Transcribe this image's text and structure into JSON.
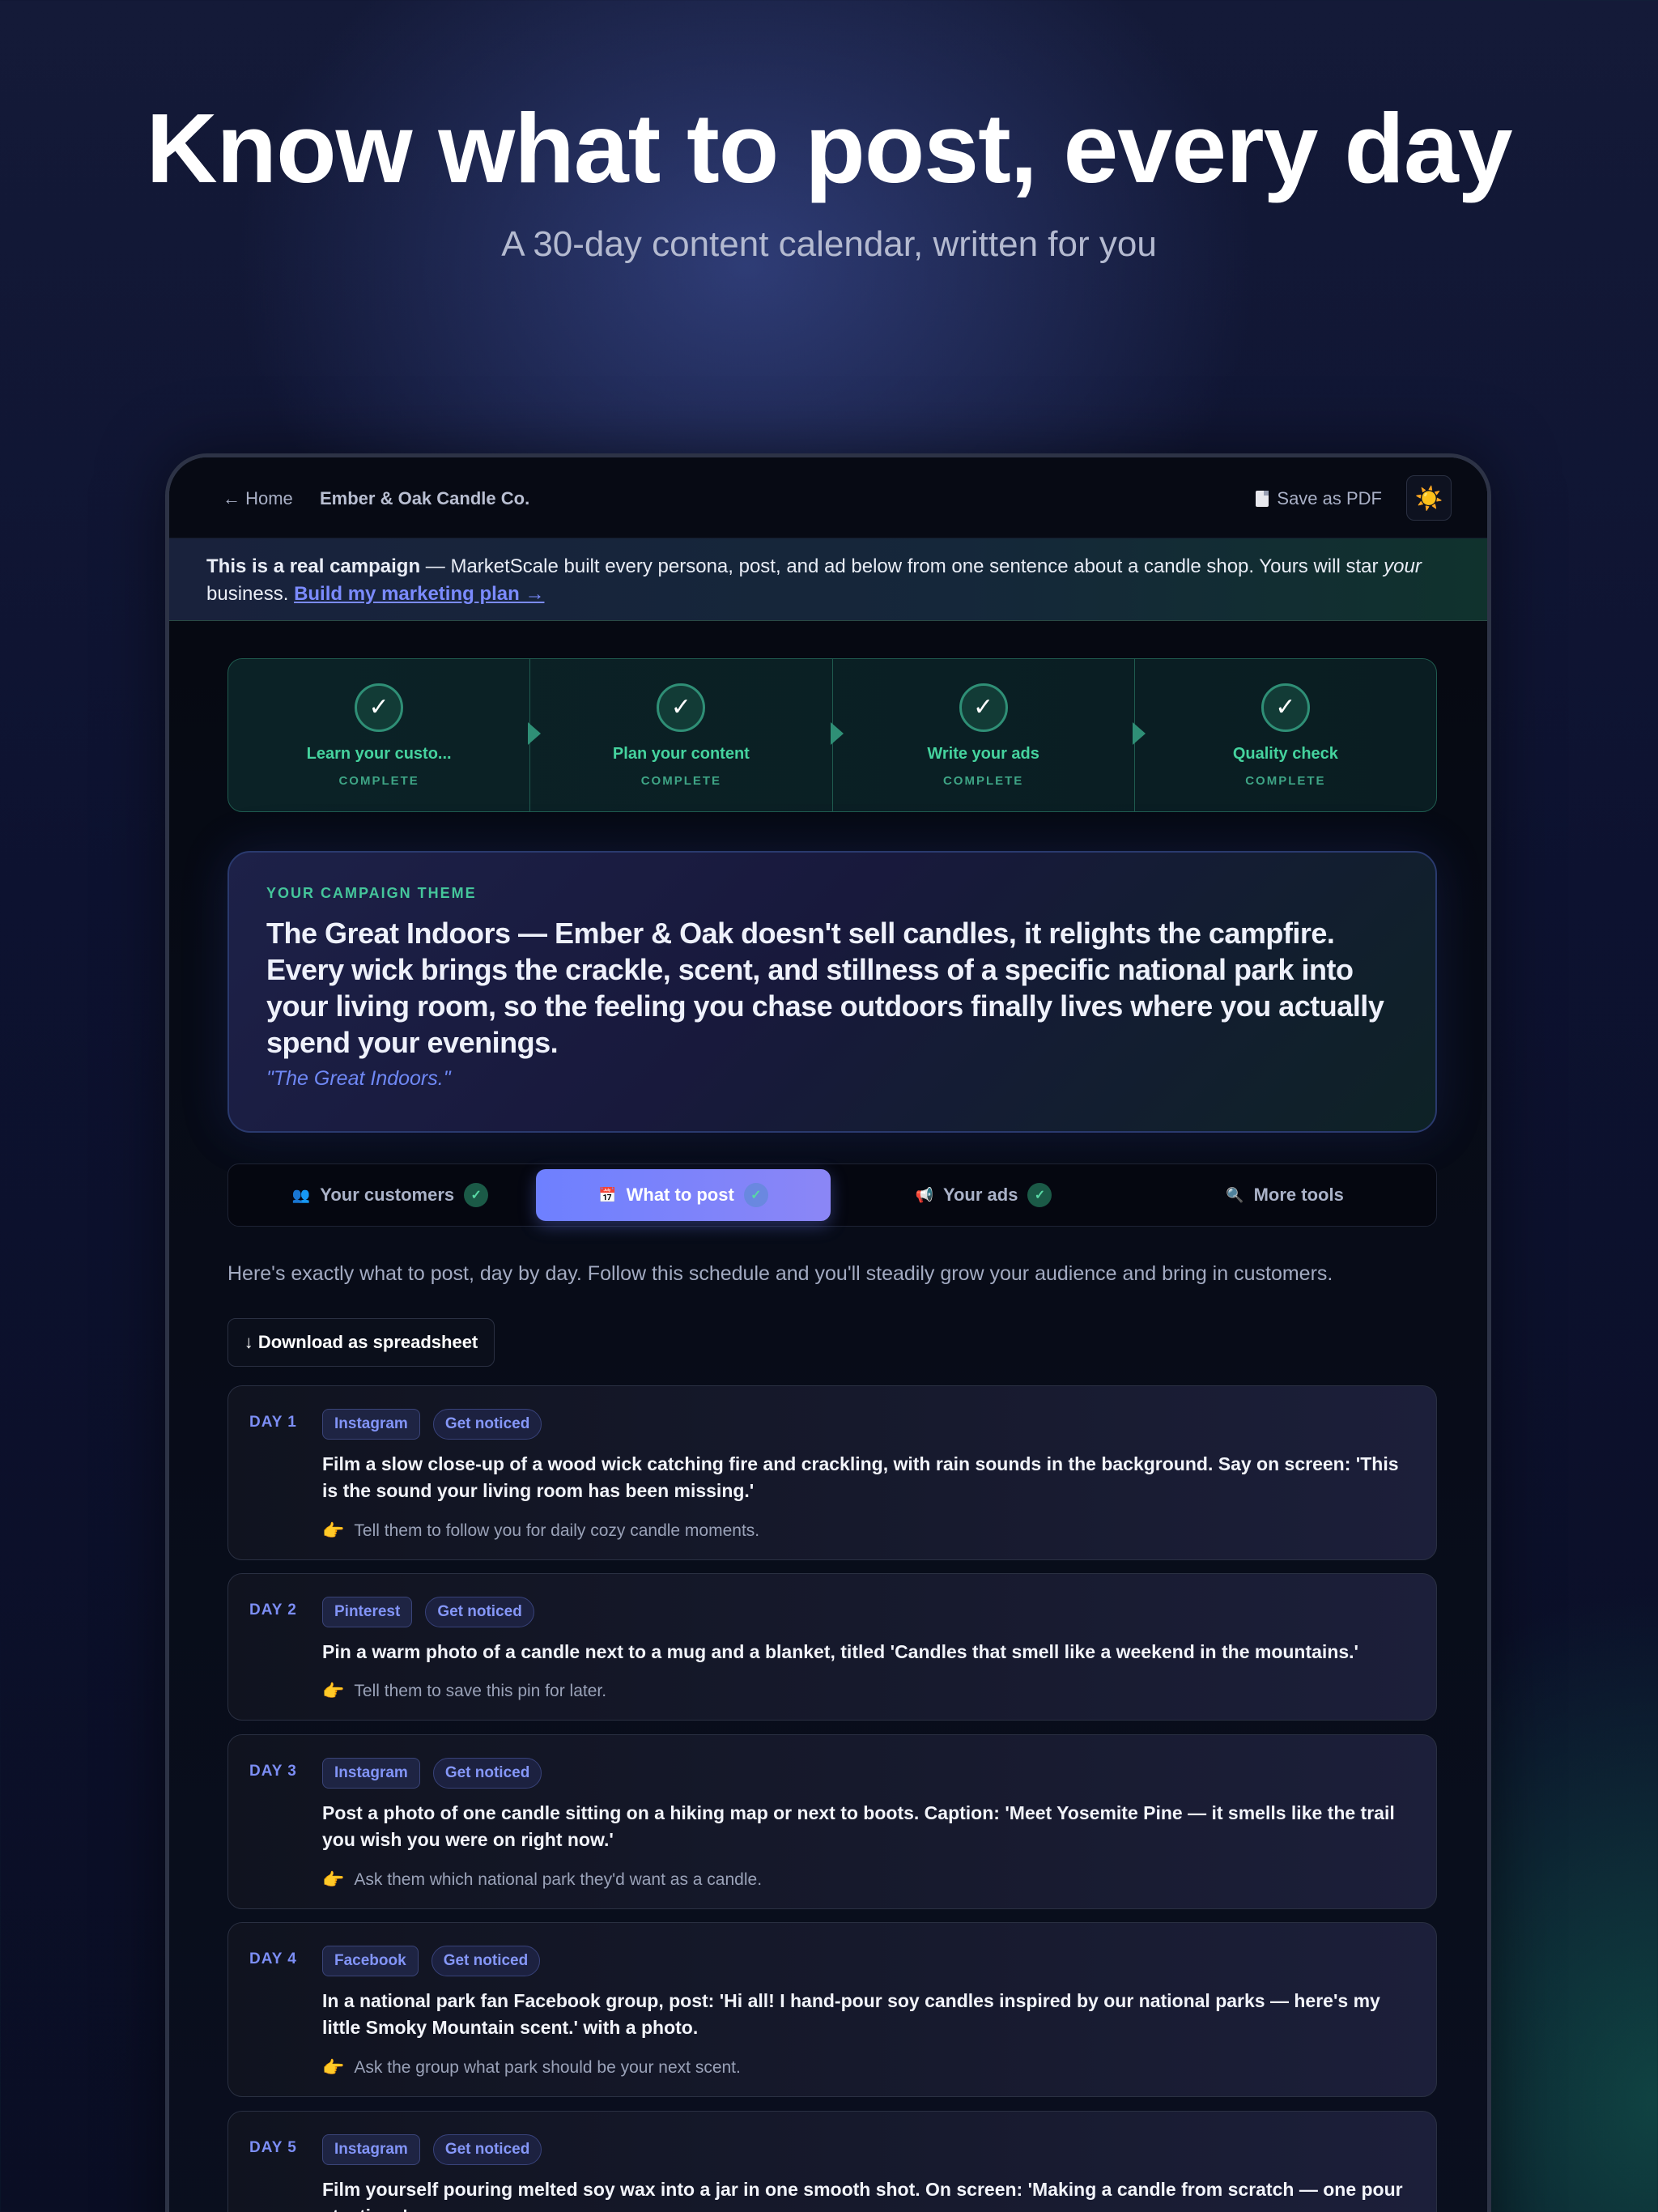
{
  "hero": {
    "title": "Know what to post, every day",
    "subtitle": "A 30-day content calendar, written for you"
  },
  "nav": {
    "home": "← Home",
    "brand": "Ember & Oak Candle Co.",
    "save_pdf": "Save as PDF",
    "theme_toggle_icon": "☀️"
  },
  "banner": {
    "bold": "This is a real campaign",
    "text": " — MarketScale built every persona, post, and ad below from one sentence about a candle shop. Yours will star ",
    "italic": "your",
    "text2": " business. ",
    "link": "Build my marketing plan →"
  },
  "steps": [
    {
      "title": "Learn your custo...",
      "status": "COMPLETE"
    },
    {
      "title": "Plan your content",
      "status": "COMPLETE"
    },
    {
      "title": "Write your ads",
      "status": "COMPLETE"
    },
    {
      "title": "Quality check",
      "status": "COMPLETE"
    }
  ],
  "campaign_theme": {
    "label": "YOUR CAMPAIGN THEME",
    "body": "The Great Indoors — Ember & Oak doesn't sell candles, it relights the campfire. Every wick brings the crackle, scent, and stillness of a specific national park into your living room, so the feeling you chase outdoors finally lives where you actually spend your evenings.",
    "tagline": "\"The Great Indoors.\""
  },
  "tabs": [
    {
      "icon": "👥",
      "label": "Your customers",
      "check": "✓",
      "active": false
    },
    {
      "icon": "📅",
      "label": "What to post",
      "check": "✓",
      "active": true
    },
    {
      "icon": "📢",
      "label": "Your ads",
      "check": "✓",
      "active": false
    },
    {
      "icon": "🔍",
      "label": "More tools",
      "active": false
    }
  ],
  "intro": "Here's exactly what to post, day by day. Follow this schedule and you'll steadily grow your audience and bring in customers.",
  "download_label": "↓ Download as spreadsheet",
  "days": [
    {
      "day": "DAY 1",
      "platform": "Instagram",
      "goal": "Get noticed",
      "text": "Film a slow close-up of a wood wick catching fire and crackling, with rain sounds in the background. Say on screen: 'This is the sound your living room has been missing.'",
      "cta": "Tell them to follow you for daily cozy candle moments."
    },
    {
      "day": "DAY 2",
      "platform": "Pinterest",
      "goal": "Get noticed",
      "text": "Pin a warm photo of a candle next to a mug and a blanket, titled 'Candles that smell like a weekend in the mountains.'",
      "cta": "Tell them to save this pin for later."
    },
    {
      "day": "DAY 3",
      "platform": "Instagram",
      "goal": "Get noticed",
      "text": "Post a photo of one candle sitting on a hiking map or next to boots. Caption: 'Meet Yosemite Pine — it smells like the trail you wish you were on right now.'",
      "cta": "Ask them which national park they'd want as a candle."
    },
    {
      "day": "DAY 4",
      "platform": "Facebook",
      "goal": "Get noticed",
      "text": "In a national park fan Facebook group, post: 'Hi all! I hand-pour soy candles inspired by our national parks — here's my little Smoky Mountain scent.' with a photo.",
      "cta": "Ask the group what park should be your next scent."
    },
    {
      "day": "DAY 5",
      "platform": "Instagram",
      "goal": "Get noticed",
      "text": "Film yourself pouring melted soy wax into a jar in one smooth shot. On screen: 'Making a candle from scratch — one pour at a time.'",
      "cta": ""
    }
  ],
  "colors": {
    "accent": "#6e80ff",
    "success": "#45d39e",
    "cta_pointer": "#f3c33c"
  }
}
